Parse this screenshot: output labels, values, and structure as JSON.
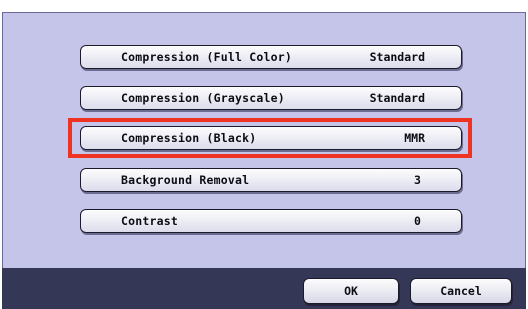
{
  "settings": [
    {
      "label": "Compression (Full Color)",
      "value": "Standard"
    },
    {
      "label": "Compression (Grayscale)",
      "value": "Standard"
    },
    {
      "label": "Compression (Black)",
      "value": "MMR"
    },
    {
      "label": "Background Removal",
      "value": "3"
    },
    {
      "label": "Contrast",
      "value": "0"
    }
  ],
  "footer": {
    "ok_label": "OK",
    "cancel_label": "Cancel"
  },
  "colors": {
    "panel_background": "#c5c5ea",
    "footer_background": "#353757",
    "highlight_border": "#ee3322"
  }
}
